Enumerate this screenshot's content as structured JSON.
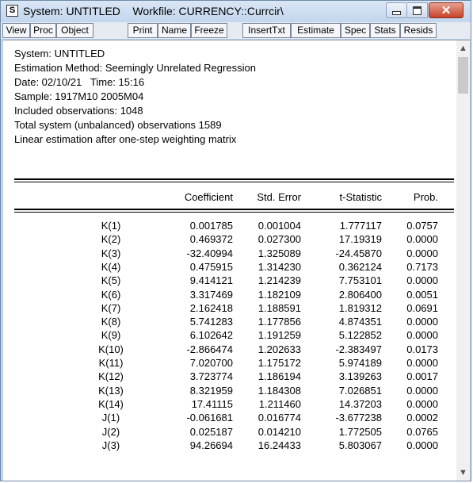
{
  "window": {
    "title": "System: UNTITLED    Workfile: CURRENCY::Currcir\\",
    "icon_letter": "S"
  },
  "toolbar": {
    "buttons": [
      "View",
      "Proc",
      "Object",
      "Print",
      "Name",
      "Freeze",
      "InsertTxt",
      "Estimate",
      "Spec",
      "Stats",
      "Resids"
    ]
  },
  "info": {
    "lines": [
      "System: UNTITLED",
      "Estimation Method: Seemingly Unrelated Regression",
      "Date: 02/10/21   Time: 15:16",
      "Sample: 1917M10 2005M04",
      "Included observations: 1048",
      "Total system (unbalanced) observations 1589",
      "Linear estimation after one-step weighting matrix"
    ]
  },
  "table": {
    "headers": [
      "Coefficient",
      "Std. Error",
      "t-Statistic",
      "Prob."
    ],
    "rows": [
      [
        "K(1)",
        "0.001785",
        "0.001004",
        "1.777117",
        "0.0757"
      ],
      [
        "K(2)",
        "0.469372",
        "0.027300",
        "17.19319",
        "0.0000"
      ],
      [
        "K(3)",
        "-32.40994",
        "1.325089",
        "-24.45870",
        "0.0000"
      ],
      [
        "K(4)",
        "0.475915",
        "1.314230",
        "0.362124",
        "0.7173"
      ],
      [
        "K(5)",
        "9.414121",
        "1.214239",
        "7.753101",
        "0.0000"
      ],
      [
        "K(6)",
        "3.317469",
        "1.182109",
        "2.806400",
        "0.0051"
      ],
      [
        "K(7)",
        "2.162418",
        "1.188591",
        "1.819312",
        "0.0691"
      ],
      [
        "K(8)",
        "5.741283",
        "1.177856",
        "4.874351",
        "0.0000"
      ],
      [
        "K(9)",
        "6.102642",
        "1.191259",
        "5.122852",
        "0.0000"
      ],
      [
        "K(10)",
        "-2.866474",
        "1.202633",
        "-2.383497",
        "0.0173"
      ],
      [
        "K(11)",
        "7.020700",
        "1.175172",
        "5.974189",
        "0.0000"
      ],
      [
        "K(12)",
        "3.723774",
        "1.186194",
        "3.139263",
        "0.0017"
      ],
      [
        "K(13)",
        "8.321959",
        "1.184308",
        "7.026851",
        "0.0000"
      ],
      [
        "K(14)",
        "17.41115",
        "1.211460",
        "14.37203",
        "0.0000"
      ],
      [
        "J(1)",
        "-0.061681",
        "0.016774",
        "-3.677238",
        "0.0002"
      ],
      [
        "J(2)",
        "0.025187",
        "0.014210",
        "1.772505",
        "0.0765"
      ],
      [
        "J(3)",
        "94.26694",
        "16.24433",
        "5.803067",
        "0.0000"
      ]
    ]
  }
}
